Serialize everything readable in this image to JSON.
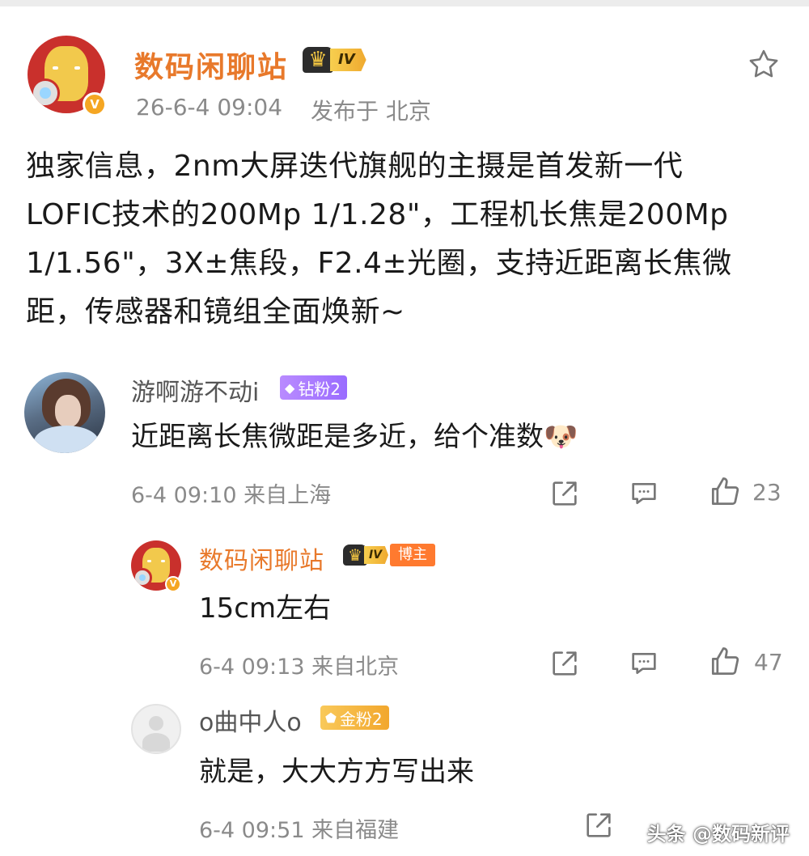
{
  "post": {
    "author": "数码闲聊站",
    "level": "IV",
    "verified": "V",
    "time": "26-6-4 09:04",
    "location": "发布于 北京",
    "body": "独家信息，2nm大屏迭代旗舰的主摄是首发新一代LOFIC技术的200Mp 1/1.28\"，工程机长焦是200Mp 1/1.56\"，3X±焦段，F2.4±光圈，支持近距离长焦微距，传感器和镜组全面焕新~"
  },
  "comments": [
    {
      "user": "游啊游不动i",
      "badge": "钻粉2",
      "text": "近距离长焦微距是多近，给个准数",
      "emoji": "🐶",
      "meta": "6-4 09:10 来自上海",
      "likes": "23",
      "replies": [
        {
          "user": "数码闲聊站",
          "level": "IV",
          "role": "博主",
          "text": "15cm左右",
          "meta": "6-4 09:13 来自北京",
          "likes": "47"
        },
        {
          "user": "o曲中人o",
          "badge": "金粉2",
          "text": "就是，大大方方写出来",
          "meta": "6-4 09:51 来自福建"
        }
      ]
    }
  ],
  "watermark": "头条 @数码新评",
  "icons": [
    "star-icon",
    "share-icon",
    "comment-icon",
    "like-icon"
  ],
  "colors": {
    "accent": "#e8792b",
    "meta": "#8a8a8a",
    "diamond_fan": "#9a6cff",
    "gold_fan": "#f2a72d"
  }
}
